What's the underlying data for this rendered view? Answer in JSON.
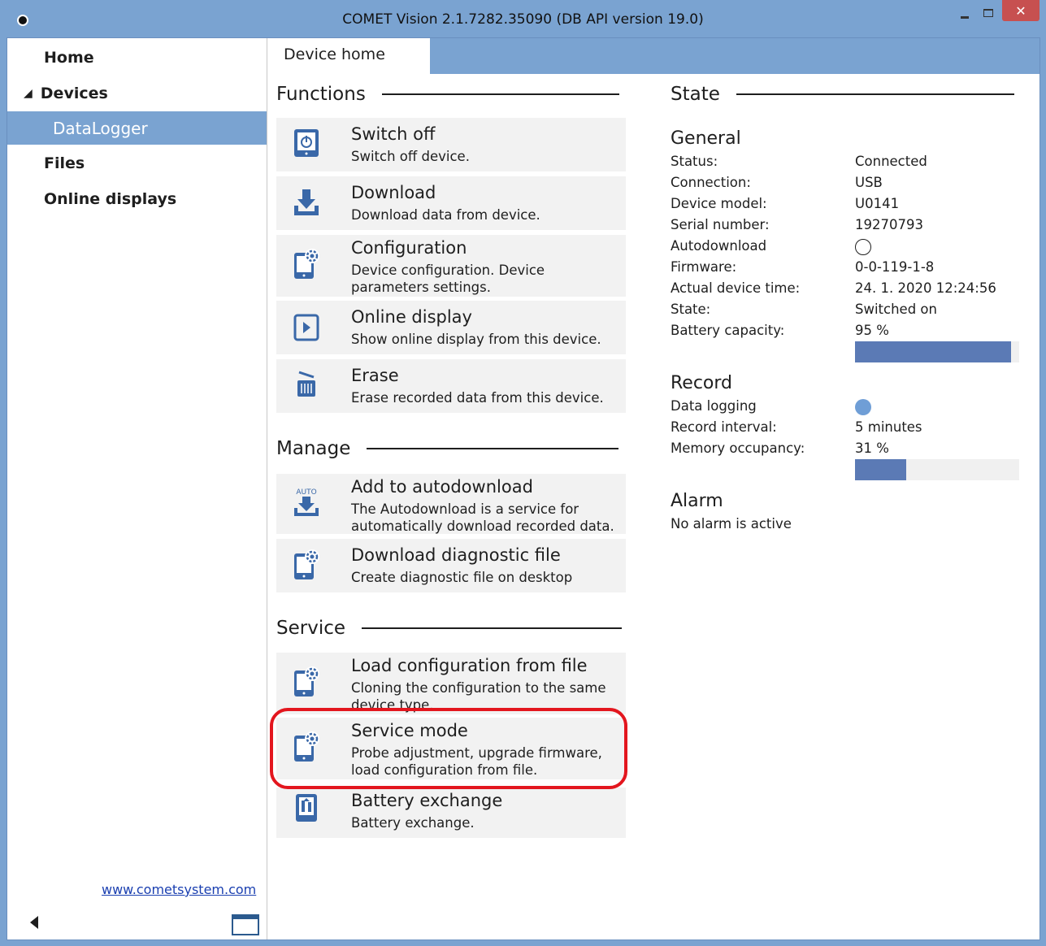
{
  "window": {
    "title": "COMET Vision 2.1.7282.35090 (DB API version 19.0)",
    "accent_color": "#7aa3d1",
    "close_label": "✕"
  },
  "sidebar": {
    "home": "Home",
    "devices": "Devices",
    "devices_glyph": "◢",
    "datalogger": "DataLogger",
    "files": "Files",
    "online_displays": "Online displays",
    "website": "www.cometsystem.com"
  },
  "tabs": {
    "device_home": "Device home"
  },
  "functions": {
    "heading": "Functions",
    "items": [
      {
        "title": "Switch off",
        "desc": "Switch off device.",
        "icon": "power-icon"
      },
      {
        "title": "Download",
        "desc": "Download data from device.",
        "icon": "download-icon"
      },
      {
        "title": "Configuration",
        "desc": "Device configuration. Device parameters settings.",
        "icon": "device-config-icon"
      },
      {
        "title": "Online display",
        "desc": "Show online display from this device.",
        "icon": "play-icon"
      },
      {
        "title": "Erase",
        "desc": "Erase recorded data from this device.",
        "icon": "trash-icon"
      }
    ]
  },
  "manage": {
    "heading": "Manage",
    "items": [
      {
        "title": "Add to autodownload",
        "desc": "The Autodownload is a service for automatically download recorded data.",
        "icon": "autodownload-icon",
        "icon_text": "AUTO"
      },
      {
        "title": "Download diagnostic file",
        "desc": "Create diagnostic file on desktop",
        "icon": "device-config-icon"
      }
    ]
  },
  "service": {
    "heading": "Service",
    "items": [
      {
        "title": "Load configuration from file",
        "desc": "Cloning the configuration to the same device type.",
        "icon": "device-config-icon"
      },
      {
        "title": "Service mode",
        "desc": "Probe adjustment, upgrade firmware, load configuration from file.",
        "icon": "device-config-icon"
      },
      {
        "title": "Battery exchange",
        "desc": "Battery exchange.",
        "icon": "battery-icon"
      }
    ]
  },
  "state": {
    "heading": "State",
    "general": {
      "heading": "General",
      "status_label": "Status:",
      "status_value": "Connected",
      "connection_label": "Connection:",
      "connection_value": "USB",
      "model_label": "Device model:",
      "model_value": "U0141",
      "serial_label": "Serial number:",
      "serial_value": "19270793",
      "autodownload_label": "Autodownload",
      "autodownload_on": false,
      "firmware_label": "Firmware:",
      "firmware_value": "0-0-119-1-8",
      "time_label": "Actual device time:",
      "time_value": "24. 1. 2020 12:24:56",
      "state_label": "State:",
      "state_value": "Switched on",
      "battery_label": "Battery capacity:",
      "battery_value": "95 %",
      "battery_fraction": 0.95
    },
    "record": {
      "heading": "Record",
      "logging_label": "Data logging",
      "logging_on": true,
      "interval_label": "Record interval:",
      "interval_value": "5 minutes",
      "memory_label": "Memory occupancy:",
      "memory_value": "31 %",
      "memory_fraction": 0.31
    },
    "alarm": {
      "heading": "Alarm",
      "status": "No alarm is active"
    }
  }
}
